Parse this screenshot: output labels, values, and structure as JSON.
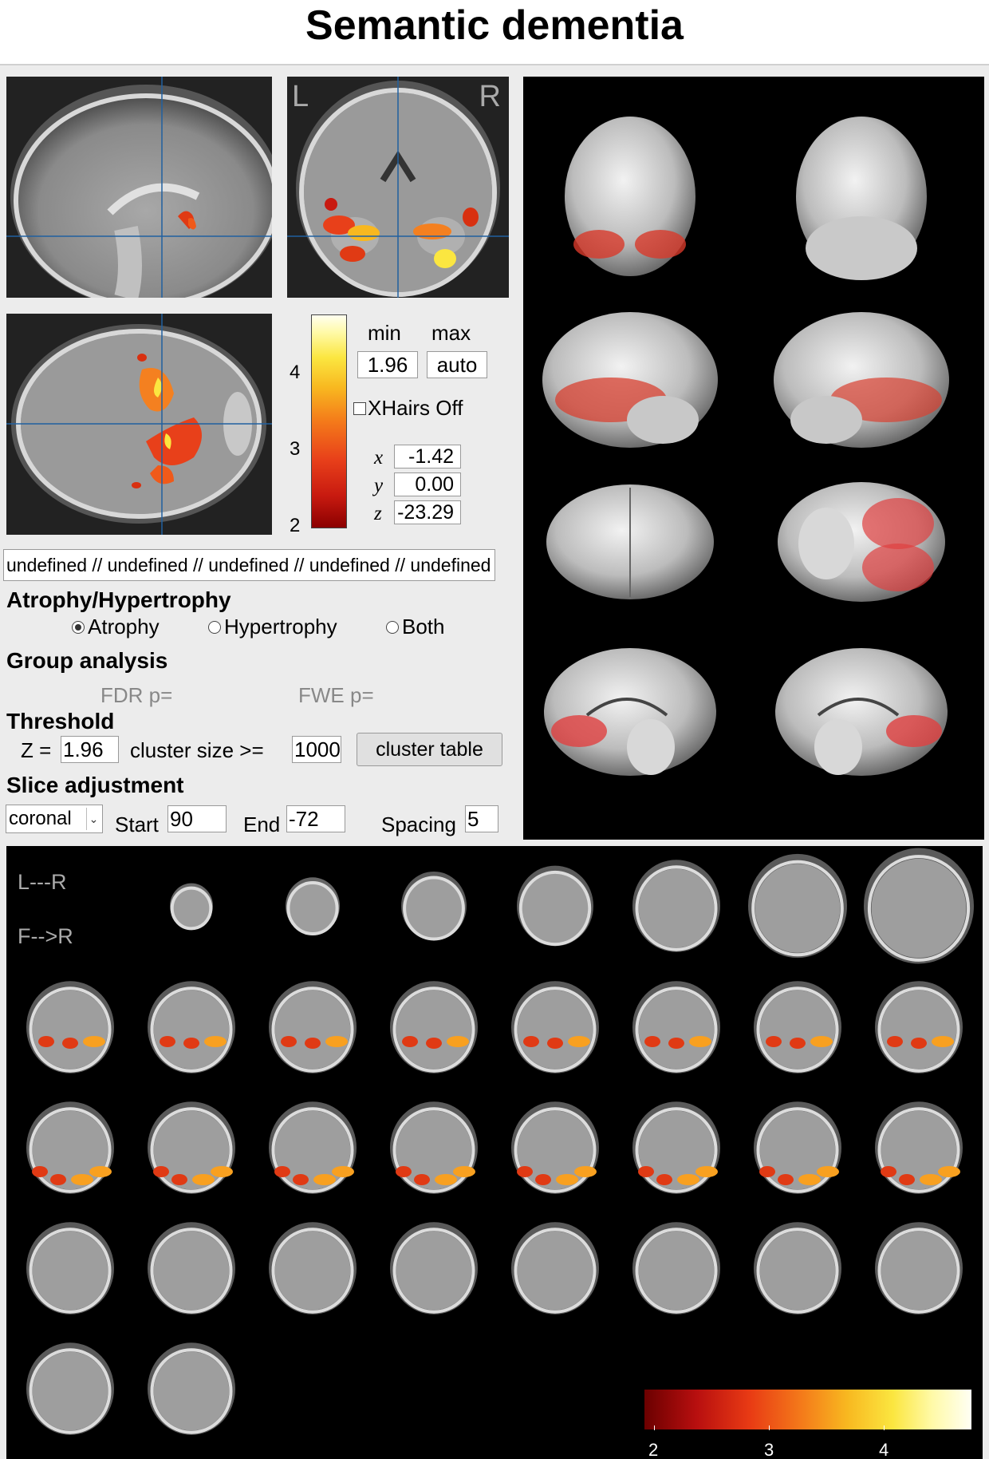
{
  "title": "Semantic dementia",
  "orthoview": {
    "label_left": "L",
    "label_right": "R"
  },
  "colorbar": {
    "ticks": [
      "4",
      "3",
      "2"
    ],
    "min_label": "min",
    "max_label": "max",
    "min_value": "1.96",
    "max_value": "auto"
  },
  "xhairs_label": "XHairs Off",
  "coords": {
    "x_label": "x",
    "x_value": "-1.42",
    "y_label": "y",
    "y_value": "0.00",
    "z_label": "z",
    "z_value": "-23.29"
  },
  "path_text": "undefined // undefined // undefined // undefined // undefined",
  "atrophy": {
    "heading": "Atrophy/Hypertrophy",
    "options": [
      "Atrophy",
      "Hypertrophy",
      "Both"
    ],
    "selected": "Atrophy"
  },
  "group": {
    "heading": "Group analysis",
    "fdr_label": "FDR p=",
    "fwe_label": "FWE p="
  },
  "threshold": {
    "heading": "Threshold",
    "z_label": "Z =",
    "z_value": "1.96",
    "cluster_label": "cluster size >=",
    "cluster_value": "1000",
    "cluster_button": "cluster table"
  },
  "slice": {
    "heading": "Slice adjustment",
    "orientation": "coronal",
    "start_label": "Start",
    "start_value": "90",
    "end_label": "End",
    "end_value": "-72",
    "spacing_label": "Spacing",
    "spacing_value": "5"
  },
  "montage": {
    "label_lr": "L---R",
    "label_fr": "F-->R",
    "colorbar_ticks": [
      "2",
      "3",
      "4"
    ]
  },
  "colors": {
    "panel_bg": "#ececec",
    "heat_low": "#8b0000",
    "heat_mid": "#f47a1a",
    "heat_high": "#fffff0"
  }
}
